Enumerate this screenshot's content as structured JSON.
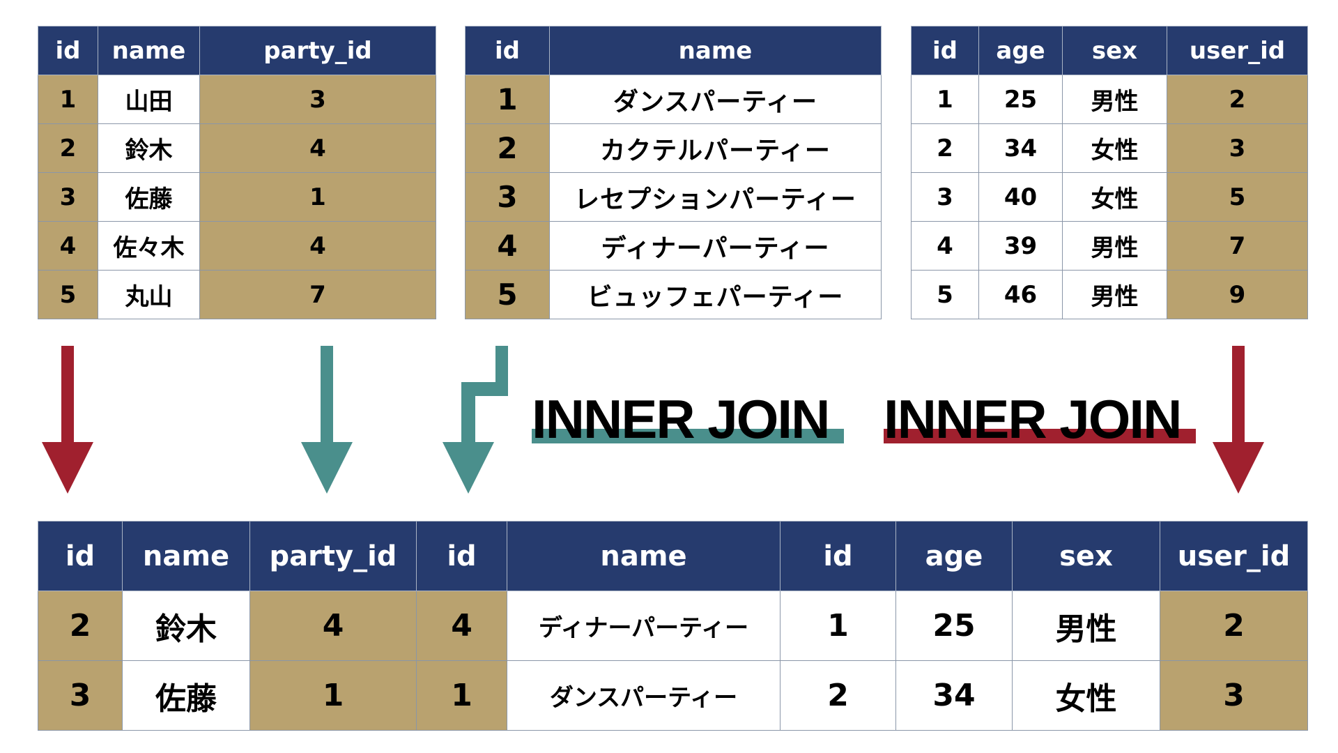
{
  "colors": {
    "header_bg": "#263b6e",
    "key_cell_bg": "#b9a26f",
    "plain_cell_bg": "#ffffff",
    "join1_color": "#4a8f8c",
    "join2_color": "#a0202e"
  },
  "users_table": {
    "headers": [
      "id",
      "name",
      "party_id"
    ],
    "rows": [
      [
        "1",
        "山田",
        "3"
      ],
      [
        "2",
        "鈴木",
        "4"
      ],
      [
        "3",
        "佐藤",
        "1"
      ],
      [
        "4",
        "佐々木",
        "4"
      ],
      [
        "5",
        "丸山",
        "7"
      ]
    ]
  },
  "parties_table": {
    "headers": [
      "id",
      "name"
    ],
    "rows": [
      [
        "1",
        "ダンスパーティー"
      ],
      [
        "2",
        "カクテルパーティー"
      ],
      [
        "3",
        "レセプションパーティー"
      ],
      [
        "4",
        "ディナーパーティー"
      ],
      [
        "5",
        "ビュッフェパーティー"
      ]
    ]
  },
  "profiles_table": {
    "headers": [
      "id",
      "age",
      "sex",
      "user_id"
    ],
    "rows": [
      [
        "1",
        "25",
        "男性",
        "2"
      ],
      [
        "2",
        "34",
        "女性",
        "3"
      ],
      [
        "3",
        "40",
        "女性",
        "5"
      ],
      [
        "4",
        "39",
        "男性",
        "7"
      ],
      [
        "5",
        "46",
        "男性",
        "9"
      ]
    ]
  },
  "joins": {
    "join1_label": "INNER JOIN",
    "join2_label": "INNER JOIN"
  },
  "result_table": {
    "headers": [
      "id",
      "name",
      "party_id",
      "id",
      "name",
      "id",
      "age",
      "sex",
      "user_id"
    ],
    "rows": [
      [
        "2",
        "鈴木",
        "4",
        "4",
        "ディナーパーティー",
        "1",
        "25",
        "男性",
        "2"
      ],
      [
        "3",
        "佐藤",
        "1",
        "1",
        "ダンスパーティー",
        "2",
        "34",
        "女性",
        "3"
      ]
    ]
  }
}
